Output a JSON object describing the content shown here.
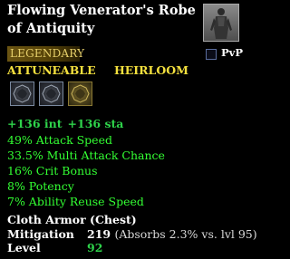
{
  "item": {
    "name": "Flowing Venerator's Robe of Antiquity",
    "rarity": "LEGENDARY",
    "flags": [
      "ATTUNEABLE",
      "HEIRLOOM"
    ],
    "pvp_label": "PvP",
    "pvp_checked": false
  },
  "adornment_slots": [
    {
      "name": "adornment-slot-1",
      "color": "grey"
    },
    {
      "name": "adornment-slot-2",
      "color": "grey"
    },
    {
      "name": "adornment-slot-3",
      "color": "gold"
    }
  ],
  "stats": {
    "int": "+136 int",
    "sta": "+136 sta"
  },
  "effects": [
    "49% Attack Speed",
    "33.5% Multi Attack Chance",
    "16% Crit Bonus",
    "8% Potency",
    "7% Ability Reuse Speed"
  ],
  "armor": {
    "type": "Cloth Armor (Chest)",
    "mitigation_label": "Mitigation",
    "mitigation_value": "219",
    "mitigation_note": "(Absorbs 2.3% vs. lvl 95)",
    "level_label": "Level",
    "level_value": "92"
  },
  "colors": {
    "background": "#000000",
    "stat_green": "#2ed24a",
    "effect_green": "#33ff33",
    "flag_yellow": "#f4e03e",
    "legendary_gold": "#e6cf6a"
  },
  "icons": {
    "portrait": "robe-figure-icon",
    "adornment": "adornment-slot-icon"
  }
}
